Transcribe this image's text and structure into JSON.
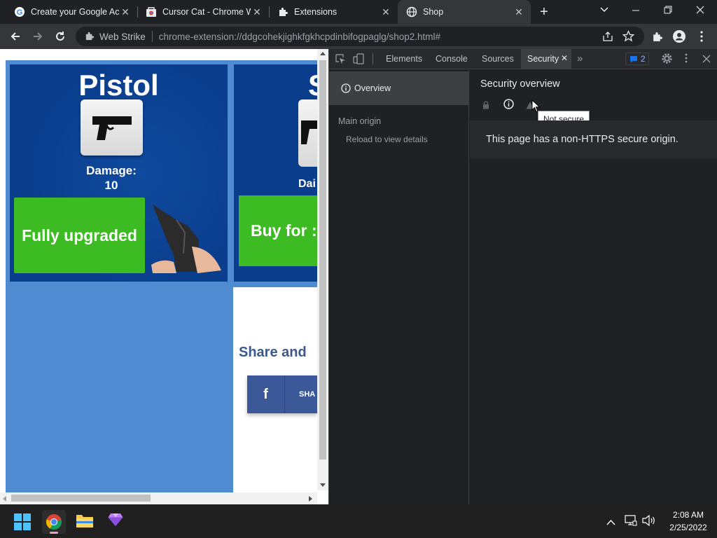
{
  "tabs": [
    {
      "title": "Create your Google Ac",
      "favicon": "google-icon"
    },
    {
      "title": "Cursor Cat - Chrome W",
      "favicon": "chrome-webstore-icon"
    },
    {
      "title": "Extensions",
      "favicon": "puzzle-icon"
    },
    {
      "title": "Shop",
      "favicon": "globe-icon",
      "active": true
    }
  ],
  "toolbar": {
    "site_name": "Web Strike",
    "url": "chrome-extension://ddgcohekjighkfgkhcpdinbifogpaglg/shop2.html#"
  },
  "shop": {
    "card1": {
      "title": "Pistol",
      "damage_label": "Damage:",
      "damage_value": "10",
      "button": "Fully upgraded"
    },
    "card2": {
      "title_partial": "S",
      "damage_partial": "Dai",
      "button_partial": "Buy for :"
    },
    "share_text": "Share and",
    "share_button": "SHA",
    "fb_letter": "f"
  },
  "devtools": {
    "tabs": [
      "Elements",
      "Console",
      "Sources",
      "Security"
    ],
    "active_tab": "Security",
    "issues_count": "2",
    "sidebar": {
      "overview": "Overview",
      "main_origin": "Main origin",
      "reload": "Reload to view details"
    },
    "security_title": "Security overview",
    "tooltip": "Not secure",
    "message": "This page has a non-HTTPS secure origin."
  },
  "taskbar": {
    "time": "2:08 AM",
    "date": "2/25/2022"
  },
  "colors": {
    "shop_blue": "#0a3d8c",
    "page_blue": "#4f8bd0",
    "green_btn": "#3dbb22",
    "fb_blue": "#3b5998",
    "share_text": "#3a5a8c"
  }
}
